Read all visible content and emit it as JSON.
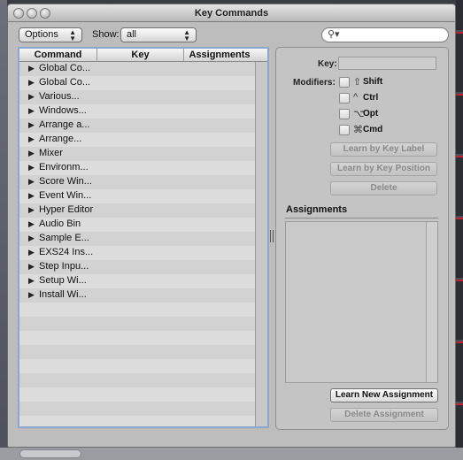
{
  "window": {
    "title": "Key Commands"
  },
  "toolbar": {
    "options_label": "Options",
    "show_label": "Show:",
    "show_value": "all",
    "search_icon": "magnifier-icon"
  },
  "table": {
    "columns": [
      "Command",
      "Key",
      "Assignments"
    ],
    "rows": [
      "Global Co...",
      "Global Co...",
      "Various...",
      "Windows...",
      "Arrange a...",
      "Arrange...",
      "Mixer",
      "Environm...",
      "Score Win...",
      "Event Win...",
      "Hyper Editor",
      "Audio Bin",
      "Sample E...",
      "EXS24 Ins...",
      "Step Inpu...",
      "Setup Wi...",
      "Install Wi..."
    ]
  },
  "right": {
    "key_label": "Key:",
    "modifiers_label": "Modifiers:",
    "modifiers": [
      {
        "symbol": "⇧",
        "name": "Shift"
      },
      {
        "symbol": "^",
        "name": "Ctrl"
      },
      {
        "symbol": "⌥",
        "name": "Opt"
      },
      {
        "symbol": "⌘",
        "name": "Cmd"
      }
    ],
    "learn_label_btn": "Learn by Key Label",
    "learn_pos_btn": "Learn by Key Position",
    "delete_btn": "Delete",
    "assignments_title": "Assignments",
    "learn_new_btn": "Learn New Assignment",
    "delete_assignment_btn": "Delete Assignment"
  }
}
